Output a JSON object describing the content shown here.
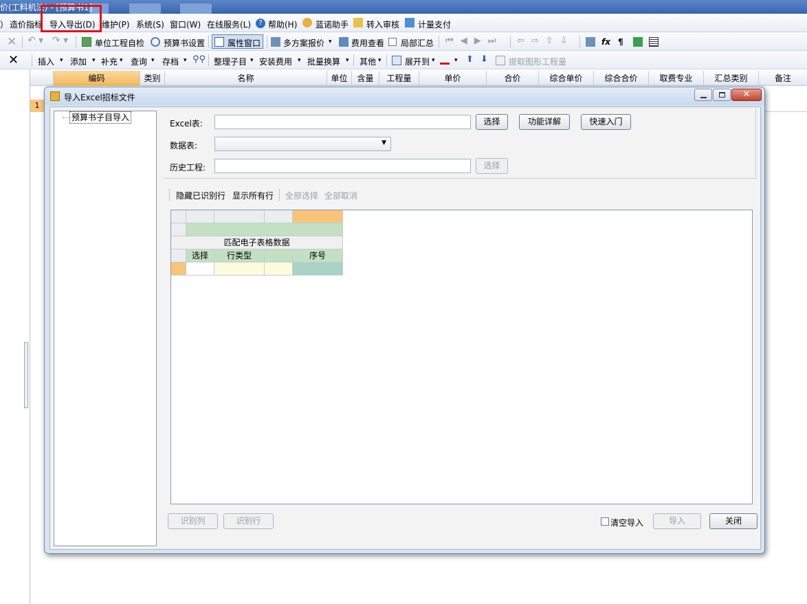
{
  "window": {
    "title": "价(工料机法) - [预算书1]"
  },
  "menu": {
    "items": [
      "）",
      "造价指标",
      "导入导出(D)",
      "维护(P)",
      "系统(S)",
      "窗口(W)",
      "在线服务(L)",
      "帮助(H)",
      "蓝诺助手",
      "转入审核",
      "计量支付"
    ]
  },
  "toolbar1": {
    "items": [
      "单位工程自检",
      "预算书设置",
      "属性窗口",
      "多方案报价",
      "费用查看",
      "局部汇总"
    ]
  },
  "toolbar2": {
    "items": [
      "插入",
      "添加",
      "补充",
      "查询",
      "存档",
      "整理子目",
      "安装费用",
      "批量换算",
      "其他",
      "展开到",
      "提取图形工程量"
    ]
  },
  "grid": {
    "headers": [
      "编码",
      "类别",
      "名称",
      "单位",
      "含量",
      "工程量",
      "单价",
      "合价",
      "综合单价",
      "综合合价",
      "取费专业",
      "汇总类别",
      "备注"
    ],
    "row_number": "1"
  },
  "dialog": {
    "title": "导入Excel招标文件",
    "tree_item": "预算书子目导入",
    "excel_label": "Excel表:",
    "sheet_label": "数据表:",
    "history_label": "历史工程:",
    "btn_select": "选择",
    "btn_help": "功能详解",
    "btn_quick": "快速入门",
    "btn_select2": "选择",
    "tb_hide": "隐藏已识别行",
    "tb_show": "显示所有行",
    "tb_selall": "全部选择",
    "tb_unsel": "全部取消",
    "grid_title": "匹配电子表格数据",
    "grid_cols": [
      "选择",
      "行类型",
      "",
      "序号"
    ],
    "btn_col": "识别列",
    "btn_row": "识别行",
    "clear_import": "清空导入",
    "btn_import": "导入",
    "btn_close": "关闭"
  },
  "colors": {
    "accent": "#3a65ad",
    "highlight": "#e0111b",
    "green_cell": "#c3e0c3",
    "orange_cell": "#f7c47a"
  }
}
